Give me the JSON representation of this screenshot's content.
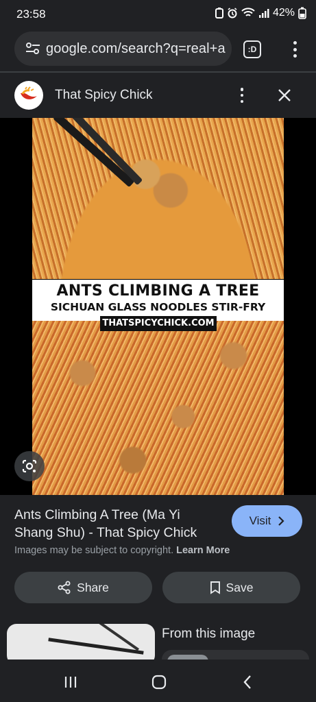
{
  "status_bar": {
    "time": "23:58",
    "battery": "42%",
    "icons": [
      "nfc-icon",
      "alarm-icon",
      "wifi-icon",
      "signal-icon",
      "battery-icon"
    ]
  },
  "browser": {
    "url": "google.com/search?q=real+a",
    "tabs_label": ":D",
    "icons": [
      "site-settings-icon",
      "tab-switcher-icon",
      "more-vert-icon"
    ]
  },
  "source": {
    "name": "That Spicy Chick",
    "icons": [
      "chili-logo-icon",
      "more-vert-icon",
      "close-icon"
    ]
  },
  "image": {
    "headline": "ANTS CLIMBING A TREE",
    "subhead": "SICHUAN GLASS NOODLES STIR-FRY",
    "site": "THATSPICYCHICK.COM",
    "lens_icon": "google-lens-icon"
  },
  "result": {
    "title": "Ants Climbing A Tree (Ma Yi Shang Shu) - That Spicy Chick",
    "visit_label": "Visit",
    "copyright_text": "Images may be subject to copyright.",
    "learn_more": "Learn More",
    "share_label": "Share",
    "save_label": "Save"
  },
  "related": {
    "heading": "From this image"
  },
  "nav": {
    "icons": [
      "recents-icon",
      "home-icon",
      "back-icon"
    ]
  },
  "colors": {
    "background": "#202124",
    "visit_button": "#8ab4f8",
    "action_button": "#3c4043",
    "url_pill": "#303134"
  }
}
